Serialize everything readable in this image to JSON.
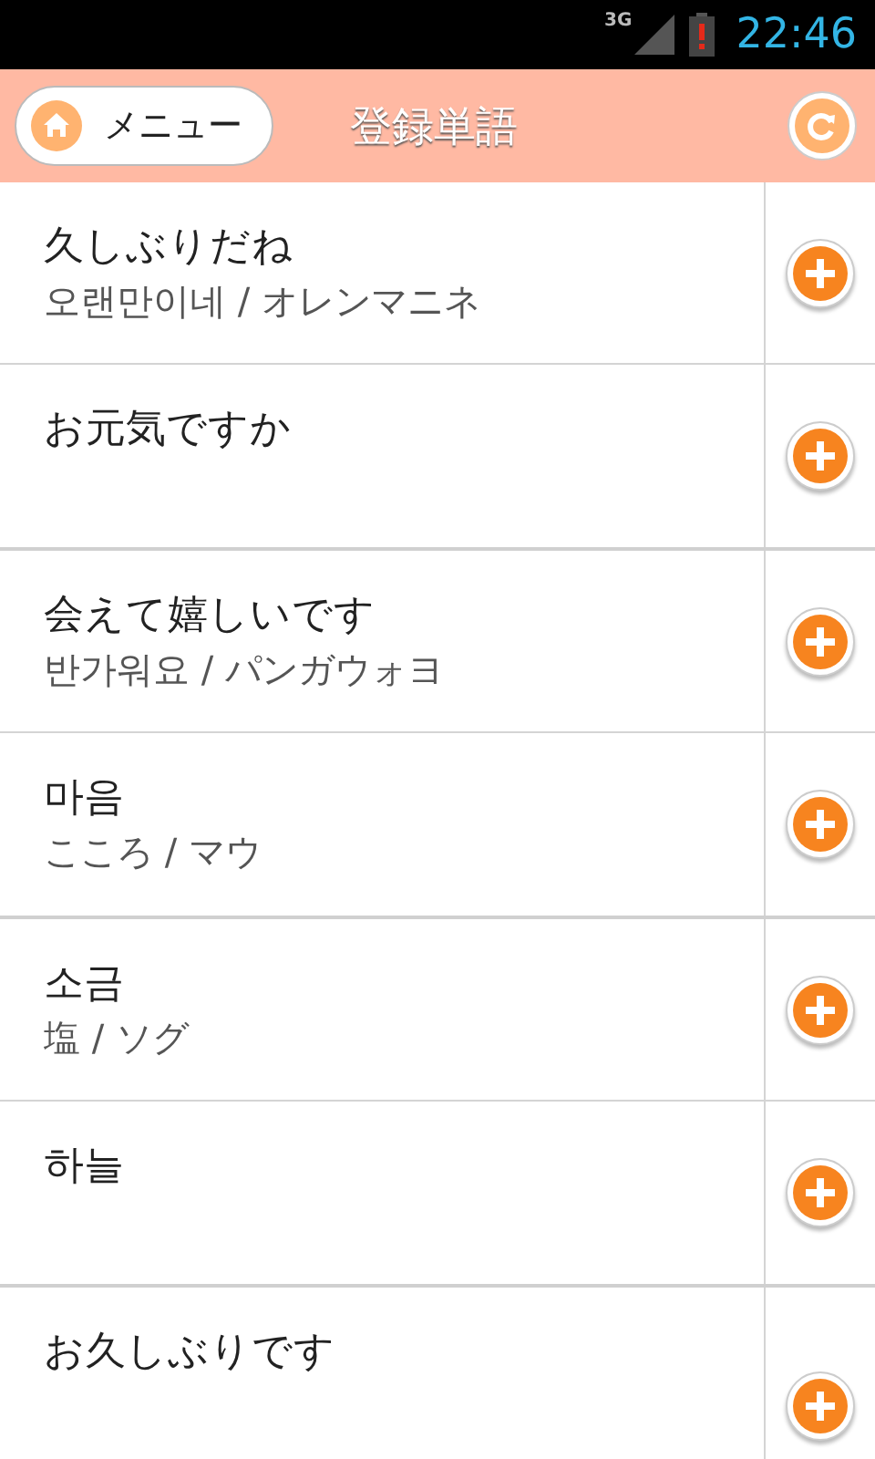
{
  "status_bar": {
    "network": "3G",
    "time": "22:46"
  },
  "header": {
    "menu_button": "メニュー",
    "title": "登録単語"
  },
  "groups": [
    {
      "entries": [
        {
          "word": "久しぶりだね",
          "reading": "오랜만이네 / オレンマニネ"
        },
        {
          "word": "お元気ですか"
        }
      ]
    },
    {
      "entries": [
        {
          "word": "会えて嬉しいです",
          "reading": "반가워요 / パンガウォヨ"
        },
        {
          "word": "마음",
          "reading": "こころ / マウ"
        }
      ]
    },
    {
      "entries": [
        {
          "word": "소금",
          "reading": "塩 / ソグ"
        },
        {
          "word": "하늘"
        }
      ]
    },
    {
      "entries": [
        {
          "word": "お久しぶりです"
        }
      ]
    }
  ]
}
